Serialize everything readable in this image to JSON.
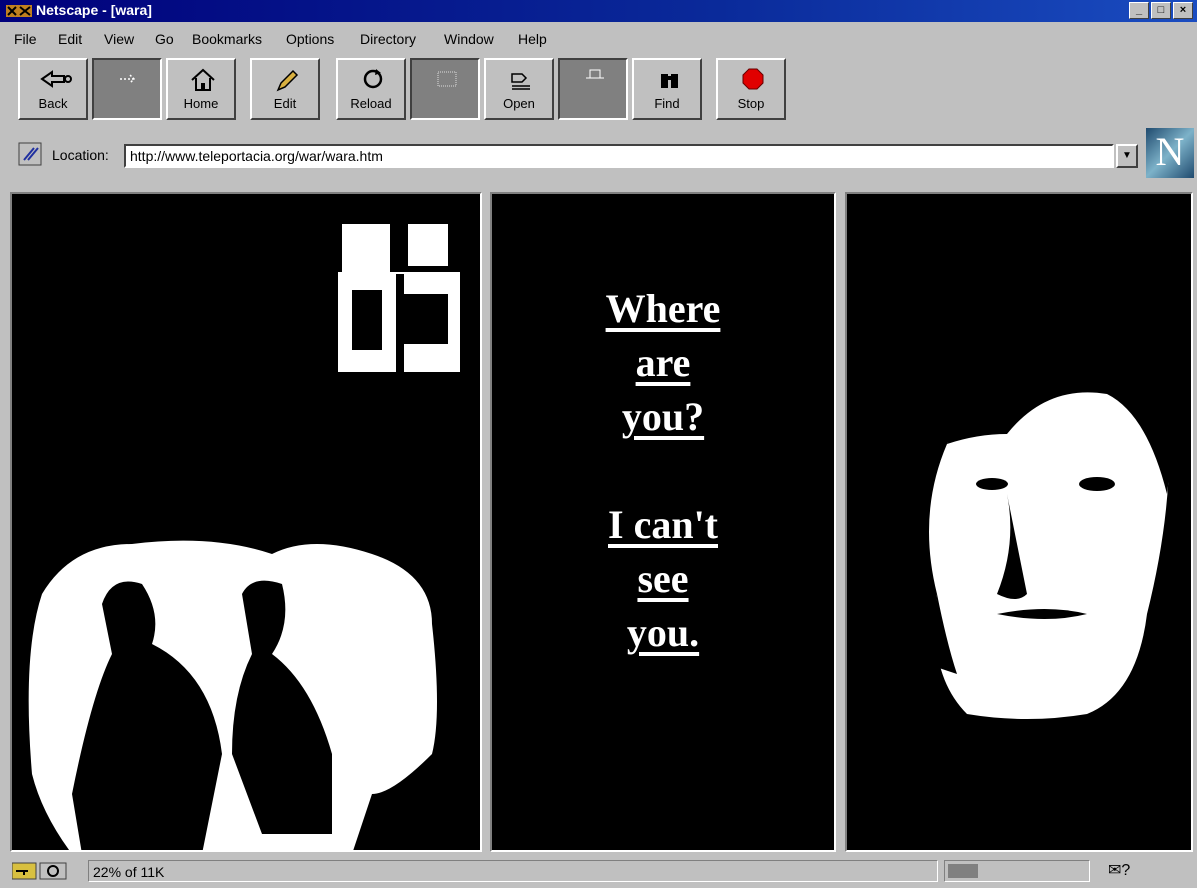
{
  "window": {
    "title": "Netscape - [wara]",
    "buttons": [
      "minimize",
      "maximize",
      "close"
    ]
  },
  "menu": [
    {
      "label": "File"
    },
    {
      "label": "Edit"
    },
    {
      "label": "View"
    },
    {
      "label": "Go"
    },
    {
      "label": "Bookmarks"
    },
    {
      "label": "Options"
    },
    {
      "label": "Directory"
    },
    {
      "label": "Window"
    },
    {
      "label": "Help"
    }
  ],
  "toolbar": {
    "back": {
      "label": "Back",
      "icon": "back-arrow-icon"
    },
    "forward": {
      "label": "",
      "icon": "forward-arrow-icon"
    },
    "home": {
      "label": "Home",
      "icon": "home-icon"
    },
    "edit": {
      "label": "Edit",
      "icon": "pencil-icon"
    },
    "reload": {
      "label": "Reload",
      "icon": "reload-icon"
    },
    "images": {
      "label": "",
      "icon": "images-icon"
    },
    "open": {
      "label": "Open",
      "icon": "open-icon"
    },
    "print": {
      "label": "",
      "icon": "print-icon"
    },
    "find": {
      "label": "Find",
      "icon": "binoculars-icon"
    },
    "stop": {
      "label": "Stop",
      "icon": "stop-icon"
    }
  },
  "location": {
    "label": "Location:",
    "url": "http://www.teleportacia.org/war/wara.htm"
  },
  "page": {
    "poem": {
      "line1": "Where",
      "line2": "are",
      "line3": "you?",
      "line4": "I can't",
      "line5": "see",
      "line6": "you."
    }
  },
  "status": {
    "text": "22% of 11K",
    "progress": 0.22
  },
  "colors": {
    "chrome": "#c0c0c0",
    "titlebar": "#00007b",
    "page_bg": "#000000",
    "page_text": "#ffffff",
    "stop": "#e00000"
  }
}
